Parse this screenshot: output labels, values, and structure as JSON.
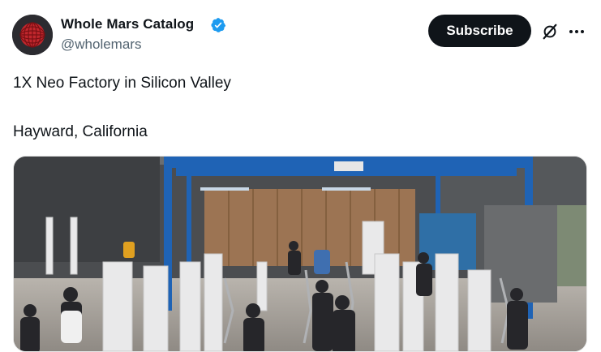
{
  "author": {
    "name": "Whole Mars Catalog",
    "handle": "@wholemars",
    "verified": true,
    "avatar": "red-sphere-avatar"
  },
  "actions": {
    "subscribe_label": "Subscribe",
    "grok_icon": "grok-slash-icon",
    "more_icon": "more-dots-icon"
  },
  "post": {
    "line1": "1X Neo Factory in Silicon Valley",
    "line2": "Hayward, California"
  },
  "media": {
    "type": "video-frame",
    "subject": "factory floor with workers assembling robots under blue gantry crane"
  },
  "colors": {
    "verified_blue": "#1d9bf0",
    "button_dark": "#0f1419",
    "secondary_text": "#536471",
    "gantry_blue": "#1f63b5"
  }
}
